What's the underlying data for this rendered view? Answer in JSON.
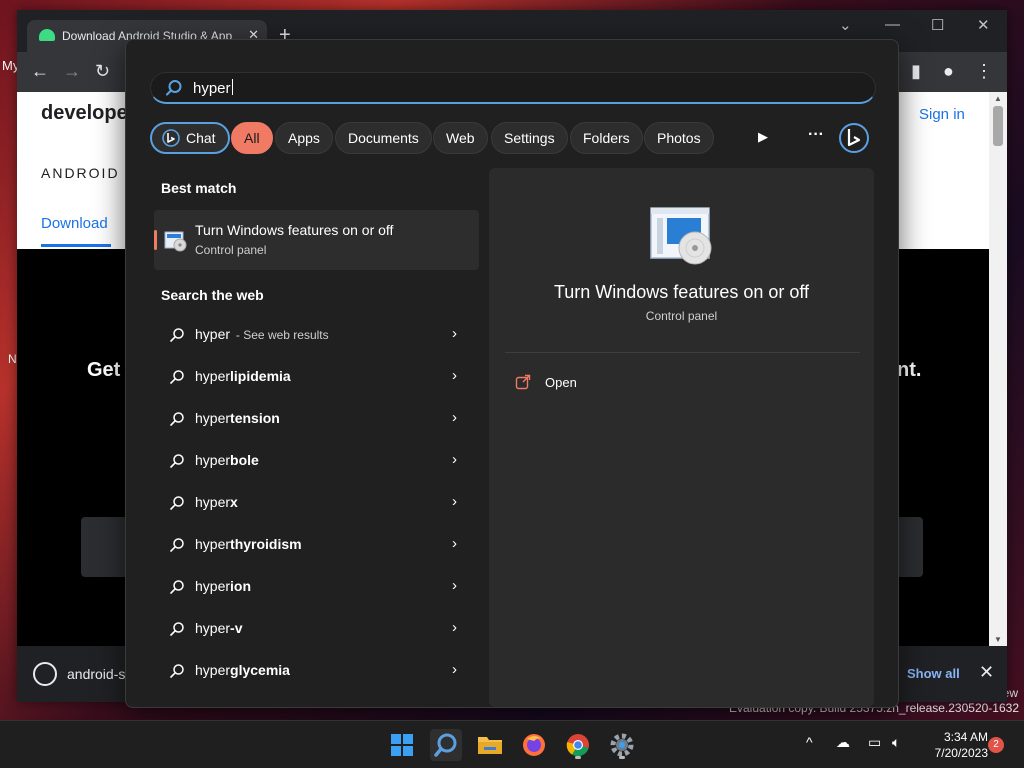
{
  "desktop": {
    "left_text": "My",
    "left_text2": "N",
    "right_text": "ew",
    "watermark": "Evaluation copy. Build 25375.zn_release.230520-1632"
  },
  "browser": {
    "tab_title": "Download Android Studio & App",
    "tab_close": "✕",
    "new_tab": "+",
    "page": {
      "brand": "develope",
      "sign_in": "Sign in",
      "subnav": "ANDROID S",
      "tab_download": "Download",
      "hero_left": "Get",
      "hero_right": "nt."
    },
    "download_bar": {
      "file_name": "android-st",
      "show_all": "Show all",
      "close": "✕"
    }
  },
  "search": {
    "query": "hyper",
    "filters": [
      {
        "label": "Chat"
      },
      {
        "label": "All"
      },
      {
        "label": "Apps"
      },
      {
        "label": "Documents"
      },
      {
        "label": "Web"
      },
      {
        "label": "Settings"
      },
      {
        "label": "Folders"
      },
      {
        "label": "Photos"
      }
    ],
    "active_filter": "All",
    "more_glyph": "···",
    "play_glyph": "▶",
    "best_match_title": "Best match",
    "best_match": {
      "title": "Turn Windows features on or off",
      "subtitle": "Control panel"
    },
    "web_title": "Search the web",
    "web_results": [
      {
        "prefix": "hyper",
        "bold": "",
        "hint": "- See web results"
      },
      {
        "prefix": "hyper",
        "bold": "lipidemia",
        "hint": ""
      },
      {
        "prefix": "hyper",
        "bold": "tension",
        "hint": ""
      },
      {
        "prefix": "hyper",
        "bold": "bole",
        "hint": ""
      },
      {
        "prefix": "hyper",
        "bold": "x",
        "hint": ""
      },
      {
        "prefix": "hyper",
        "bold": "thyroidism",
        "hint": ""
      },
      {
        "prefix": "hyper",
        "bold": "ion",
        "hint": ""
      },
      {
        "prefix": "hyper",
        "bold": "-v",
        "hint": ""
      },
      {
        "prefix": "hyper",
        "bold": "glycemia",
        "hint": ""
      }
    ],
    "detail": {
      "title": "Turn Windows features on or off",
      "subtitle": "Control panel",
      "open_label": "Open"
    }
  },
  "taskbar": {
    "time": "3:34 AM",
    "date": "7/20/2023",
    "notification_count": "2",
    "chevron": "^"
  },
  "colors": {
    "accent": "#f07a64",
    "focus_blue": "#5aa0e0",
    "flyout_bg": "#202020",
    "panel_bg": "#2b2b2b"
  }
}
